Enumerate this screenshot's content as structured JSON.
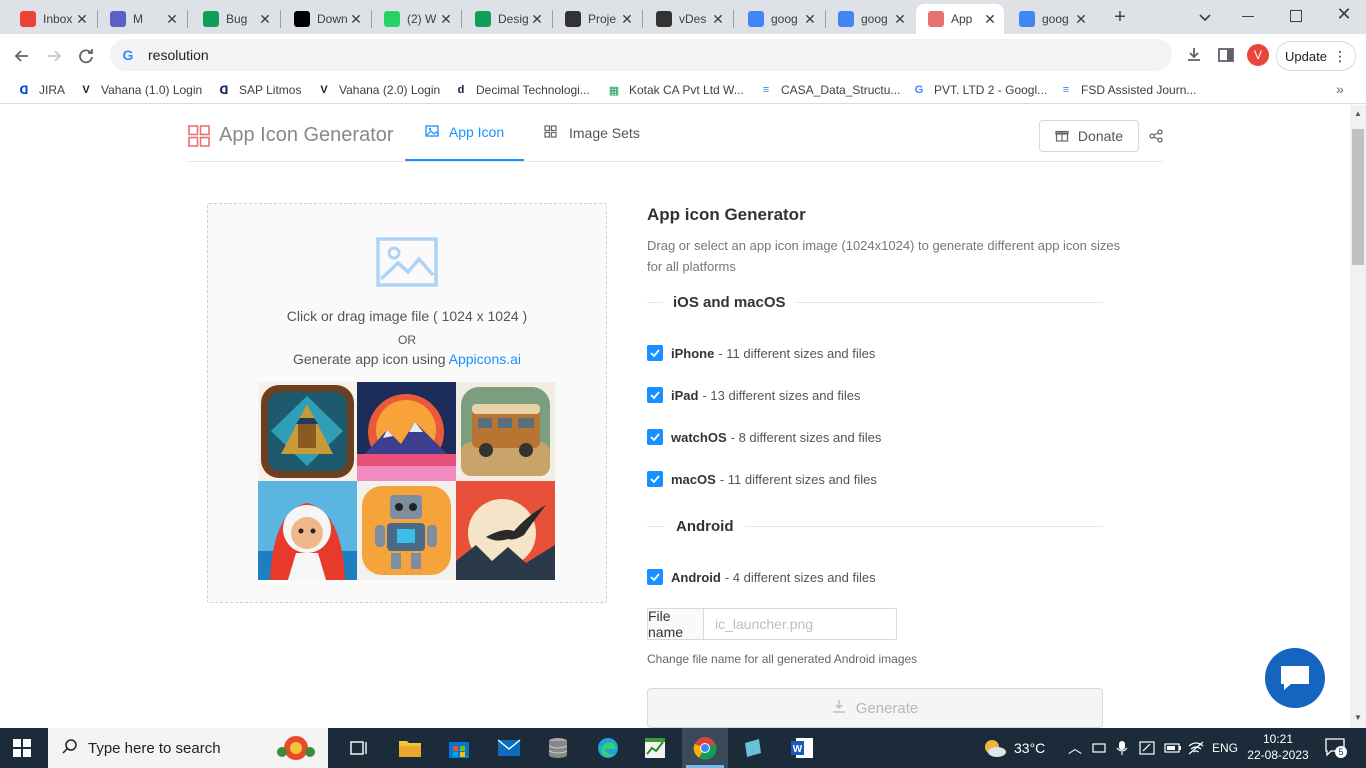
{
  "browser": {
    "tabs": [
      {
        "title": "Inbox",
        "icon": "gmail-icon",
        "color": "#ea4335"
      },
      {
        "title": "M",
        "icon": "teams-icon",
        "color": "#5b5fc7"
      },
      {
        "title": "Bug",
        "icon": "sheets-icon",
        "color": "#0f9d58"
      },
      {
        "title": "Down",
        "icon": "vercel-icon",
        "color": "#000000"
      },
      {
        "title": "(2) W",
        "icon": "whatsapp-icon",
        "color": "#25d366"
      },
      {
        "title": "Desig",
        "icon": "sheets-icon",
        "color": "#0f9d58"
      },
      {
        "title": "Proje",
        "icon": "v-logo-icon",
        "color": "#333333"
      },
      {
        "title": "vDes",
        "icon": "v-logo-icon",
        "color": "#333333"
      },
      {
        "title": "goog",
        "icon": "google-icon",
        "color": "#4285f4"
      },
      {
        "title": "goog",
        "icon": "google-icon",
        "color": "#4285f4"
      },
      {
        "title": "App",
        "icon": "app-icon-generator-icon",
        "color": "#e57373"
      },
      {
        "title": "goog",
        "icon": "google-icon",
        "color": "#4285f4"
      }
    ],
    "active_tab": 10,
    "address": "resolution",
    "profile_initial": "V",
    "update_label": "Update",
    "bookmarks": [
      {
        "label": "JIRA",
        "icon": "jira-icon"
      },
      {
        "label": "Vahana (1.0) Login",
        "icon": "v-logo-icon"
      },
      {
        "label": "SAP Litmos",
        "icon": "litmos-icon"
      },
      {
        "label": "Vahana (2.0) Login",
        "icon": "v-logo-icon"
      },
      {
        "label": "Decimal Technologi...",
        "icon": "decimal-icon"
      },
      {
        "label": "Kotak CA Pvt Ltd W...",
        "icon": "sheets-icon"
      },
      {
        "label": "CASA_Data_Structu...",
        "icon": "docs-icon"
      },
      {
        "label": "PVT. LTD 2 - Googl...",
        "icon": "google-icon"
      },
      {
        "label": "FSD Assisted Journ...",
        "icon": "docs-icon"
      }
    ]
  },
  "site": {
    "brand": "App Icon Generator",
    "nav": [
      {
        "label": "App Icon",
        "active": true,
        "icon": "image-icon"
      },
      {
        "label": "Image Sets",
        "active": false,
        "icon": "grid-icon"
      }
    ],
    "donate_label": "Donate",
    "dropzone": {
      "line1": "Click or drag image file ( 1024 x 1024 )",
      "or": "OR",
      "line3_prefix": "Generate app icon using ",
      "link": "Appicons.ai"
    },
    "heading": "App icon Generator",
    "description": "Drag or select an app icon image (1024x1024) to generate different app icon sizes for all platforms",
    "ios_section": "iOS and macOS",
    "ios_options": [
      {
        "name": "iPhone",
        "detail": " - 11 different sizes and files"
      },
      {
        "name": "iPad",
        "detail": " - 13 different sizes and files"
      },
      {
        "name": "watchOS",
        "detail": " - 8 different sizes and files"
      },
      {
        "name": "macOS",
        "detail": " - 11 different sizes and files"
      }
    ],
    "android_section": "Android",
    "android_option": {
      "name": "Android",
      "detail": " - 4 different sizes and files"
    },
    "file_name_label": "File name",
    "file_name_placeholder": "ic_launcher.png",
    "file_name_hint": "Change file name for all generated Android images",
    "generate_label": "Generate",
    "accent": "#1890ff"
  },
  "taskbar": {
    "search_placeholder": "Type here to search",
    "temperature": "33°C",
    "language": "ENG",
    "time": "10:21",
    "date": "22-08-2023",
    "notifications": "5"
  }
}
